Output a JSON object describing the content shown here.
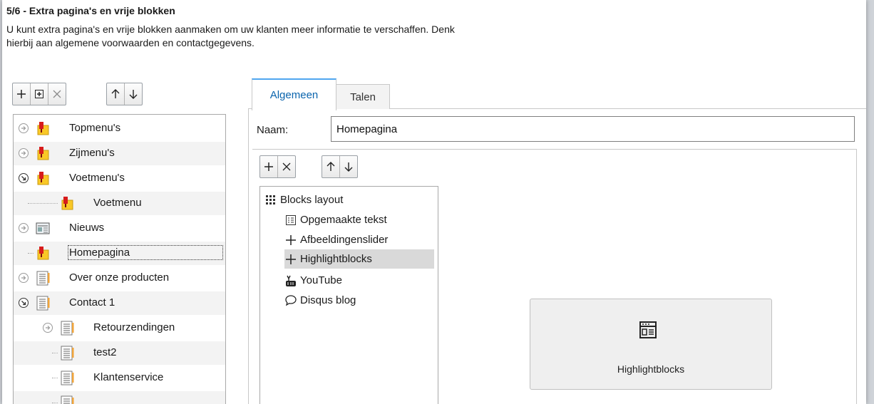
{
  "header": {
    "step_title": "5/6 - Extra pagina's en vrije blokken",
    "description_line1": "U kunt extra pagina's en vrije blokken aanmaken om uw klanten meer informatie te verschaffen. Denk",
    "description_line2": "hierbij aan algemene voorwaarden en contactgegevens."
  },
  "tree_toolbar": {
    "buttons": [
      {
        "name": "add-button",
        "icon": "plus-icon"
      },
      {
        "name": "add-child-button",
        "icon": "boxed-plus-icon"
      },
      {
        "name": "delete-button",
        "icon": "close-icon"
      },
      {
        "name": "move-up-button",
        "icon": "arrow-up-icon"
      },
      {
        "name": "move-down-button",
        "icon": "arrow-down-icon"
      }
    ]
  },
  "tree": {
    "items": [
      {
        "label": "Topmenu's",
        "icon": "menu-pin-icon",
        "expander": "collapsed"
      },
      {
        "label": "Zijmenu's",
        "icon": "menu-pin-icon",
        "expander": "collapsed"
      },
      {
        "label": "Voetmenu's",
        "icon": "menu-pin-icon",
        "expander": "expanded"
      },
      {
        "label": "Voetmenu",
        "icon": "menu-pin-icon",
        "expander": "none"
      },
      {
        "label": "Nieuws",
        "icon": "newspaper-icon",
        "expander": "collapsed"
      },
      {
        "label": "Homepagina",
        "icon": "menu-pin-icon",
        "expander": "none",
        "selected": true
      },
      {
        "label": "Over onze producten",
        "icon": "page-icon",
        "expander": "collapsed"
      },
      {
        "label": "Contact 1",
        "icon": "page-icon",
        "expander": "expanded"
      },
      {
        "label": "Retourzendingen",
        "icon": "page-icon",
        "expander": "collapsed"
      },
      {
        "label": "test2",
        "icon": "page-icon",
        "expander": "none"
      },
      {
        "label": "Klantenservice",
        "icon": "page-icon",
        "expander": "none"
      },
      {
        "label": "",
        "icon": "page-icon",
        "expander": "none"
      }
    ]
  },
  "tabs": [
    {
      "label": "Algemeen",
      "active": true
    },
    {
      "label": "Talen",
      "active": false
    }
  ],
  "form": {
    "name_label": "Naam:",
    "name_value": "Homepagina"
  },
  "blocks": {
    "items": [
      {
        "label": "Blocks layout",
        "icon": "grid-icon"
      },
      {
        "label": "Opgemaakte tekst",
        "icon": "formatted-text-icon"
      },
      {
        "label": "Afbeeldingenslider",
        "icon": "plus-icon"
      },
      {
        "label": "Highlightblocks",
        "icon": "plus-icon",
        "selected": true
      },
      {
        "label": "YouTube",
        "icon": "youtube-icon"
      },
      {
        "label": "Disqus blog",
        "icon": "speech-bubble-icon"
      }
    ]
  },
  "preview": {
    "label": "Highlightblocks",
    "icon": "highlightblocks-icon"
  },
  "colors": {
    "tab_accent": "#4fa6f0",
    "tab_text": "#0a64ad",
    "selection_bg": "#d9d9d9",
    "menu_pin_yellow": "#f9c827",
    "menu_pin_red": "#d71b1b"
  }
}
